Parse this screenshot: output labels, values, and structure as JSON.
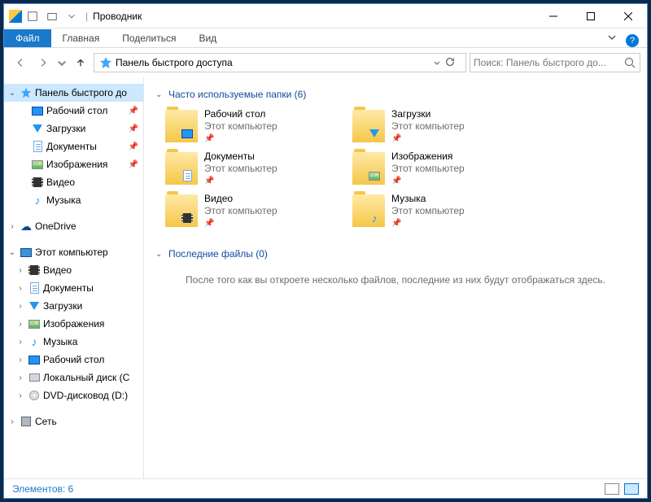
{
  "title": "Проводник",
  "tabs": {
    "file": "Файл",
    "home": "Главная",
    "share": "Поделиться",
    "view": "Вид"
  },
  "address": {
    "text": "Панель быстрого доступа"
  },
  "search": {
    "placeholder": "Поиск: Панель быстрого до..."
  },
  "sidebar": {
    "quick": {
      "label": "Панель быстрого до",
      "items": [
        {
          "label": "Рабочий стол",
          "icon": "monitor",
          "pinned": true
        },
        {
          "label": "Загрузки",
          "icon": "down",
          "pinned": true
        },
        {
          "label": "Документы",
          "icon": "doc",
          "pinned": true
        },
        {
          "label": "Изображения",
          "icon": "img",
          "pinned": true
        },
        {
          "label": "Видео",
          "icon": "vid",
          "pinned": false
        },
        {
          "label": "Музыка",
          "icon": "music",
          "pinned": false
        }
      ]
    },
    "onedrive": {
      "label": "OneDrive"
    },
    "thispc": {
      "label": "Этот компьютер",
      "items": [
        {
          "label": "Видео",
          "icon": "vid"
        },
        {
          "label": "Документы",
          "icon": "doc"
        },
        {
          "label": "Загрузки",
          "icon": "down"
        },
        {
          "label": "Изображения",
          "icon": "img"
        },
        {
          "label": "Музыка",
          "icon": "music"
        },
        {
          "label": "Рабочий стол",
          "icon": "monitor"
        },
        {
          "label": "Локальный диск (C",
          "icon": "disk"
        },
        {
          "label": "DVD-дисковод (D:)",
          "icon": "dvd"
        }
      ]
    },
    "network": {
      "label": "Сеть"
    }
  },
  "groups": {
    "frequent": {
      "title": "Часто используемые папки (6)",
      "items": [
        {
          "name": "Рабочий стол",
          "sub": "Этот компьютер",
          "ov": "monitor"
        },
        {
          "name": "Загрузки",
          "sub": "Этот компьютер",
          "ov": "down"
        },
        {
          "name": "Документы",
          "sub": "Этот компьютер",
          "ov": "doc"
        },
        {
          "name": "Изображения",
          "sub": "Этот компьютер",
          "ov": "img"
        },
        {
          "name": "Видео",
          "sub": "Этот компьютер",
          "ov": "vid"
        },
        {
          "name": "Музыка",
          "sub": "Этот компьютер",
          "ov": "music"
        }
      ]
    },
    "recent": {
      "title": "Последние файлы (0)",
      "empty": "После того как вы откроете несколько файлов, последние из них будут отображаться здесь."
    }
  },
  "status": {
    "text": "Элементов: 6"
  }
}
